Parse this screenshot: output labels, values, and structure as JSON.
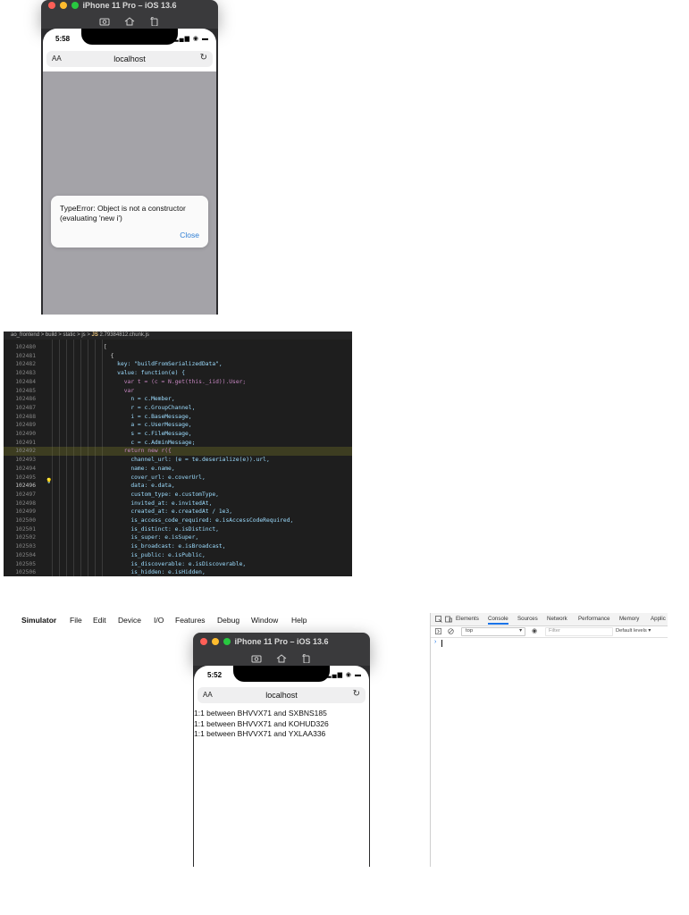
{
  "top_simulator": {
    "title": "iPhone 11 Pro – iOS 13.6",
    "status_time": "5:58",
    "status_icons": "▂▄▆ ◉ ▬",
    "url_aa": "AA",
    "url_host": "localhost",
    "url_reload": "↻",
    "alert": {
      "message": "TypeError: Object is not a constructor (evaluating 'new i')",
      "close_label": "Close"
    }
  },
  "editor": {
    "breadcrumb": {
      "parts": [
        "ao_frontend",
        ">",
        "build",
        ">",
        "static",
        ">",
        "js",
        ">"
      ],
      "file_icon": "JS",
      "file_name": "2.79384812.chunk.js"
    },
    "lines": [
      {
        "num": "102480",
        "text": "["
      },
      {
        "num": "102481",
        "text": "  {"
      },
      {
        "num": "102482",
        "text": "    key: \"buildFromSerializedData\","
      },
      {
        "num": "102483",
        "text": "    value: function(e) {"
      },
      {
        "num": "102484",
        "text": "      var t = (c = N.get(this._iid)).User;"
      },
      {
        "num": "102485",
        "text": "      var"
      },
      {
        "num": "102486",
        "text": "        n = c.Member,"
      },
      {
        "num": "102487",
        "text": "        r = c.GroupChannel,"
      },
      {
        "num": "102488",
        "text": "        i = c.BaseMessage,"
      },
      {
        "num": "102489",
        "text": "        a = c.UserMessage,"
      },
      {
        "num": "102490",
        "text": "        s = c.FileMessage,"
      },
      {
        "num": "102491",
        "text": "        c = c.AdminMessage;"
      },
      {
        "num": "102492",
        "text": "      return new r({"
      },
      {
        "num": "102493",
        "text": "        channel_url: (e = te.deserialize(e)).url,"
      },
      {
        "num": "102494",
        "text": "        name: e.name,"
      },
      {
        "num": "102495",
        "text": "        cover_url: e.coverUrl,"
      },
      {
        "num": "102496",
        "text": "        data: e.data,"
      },
      {
        "num": "102497",
        "text": "        custom_type: e.customType,"
      },
      {
        "num": "102498",
        "text": "        invited_at: e.invitedAt,"
      },
      {
        "num": "102499",
        "text": "        created_at: e.createdAt / 1e3,"
      },
      {
        "num": "102500",
        "text": "        is_access_code_required: e.isAccessCodeRequired,"
      },
      {
        "num": "102501",
        "text": "        is_distinct: e.isDistinct,"
      },
      {
        "num": "102502",
        "text": "        is_super: e.isSuper,"
      },
      {
        "num": "102503",
        "text": "        is_broadcast: e.isBroadcast,"
      },
      {
        "num": "102504",
        "text": "        is_public: e.isPublic,"
      },
      {
        "num": "102505",
        "text": "        is_discoverable: e.isDiscoverable,"
      },
      {
        "num": "102506",
        "text": "        is_hidden: e.isHidden,"
      }
    ],
    "lightbulb_icon": "💡"
  },
  "menubar": {
    "items": [
      "Simulator",
      "File",
      "Edit",
      "Device",
      "I/O",
      "Features",
      "Debug",
      "Window",
      "Help"
    ]
  },
  "bottom_simulator": {
    "title": "iPhone 11 Pro – iOS 13.6",
    "status_time": "5:52",
    "status_icons": "▂▄▆ ◉ ▬",
    "url_aa": "AA",
    "url_host": "localhost",
    "url_reload": "↻",
    "content_lines": [
      "1:1 between BHVVX71 and SXBNS185",
      "1:1 between BHVVX71 and KOHUD326",
      "1:1 between BHVVX71 and YXLAA336"
    ]
  },
  "devtools": {
    "tabs": [
      "Elements",
      "Console",
      "Sources",
      "Network",
      "Performance",
      "Memory",
      "Applic"
    ],
    "active_tab": "Console",
    "context": "top",
    "filter_placeholder": "Filter",
    "levels": "Default levels ▾",
    "prompt": "›",
    "dropdown_arrow": "▾",
    "eye_icon": "◉"
  },
  "colors": {
    "alert_link": "#2f7fd4",
    "editor_bg": "#1e1e1e",
    "active_tab_underline": "#1a73e8"
  }
}
